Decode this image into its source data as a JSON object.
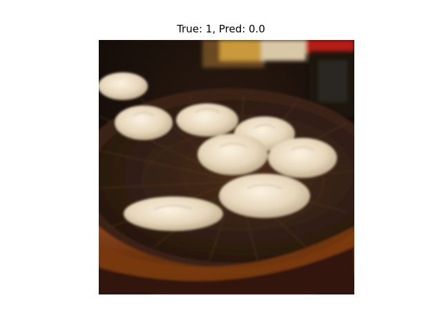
{
  "figure": {
    "title": "True: 1, Pred: 0.0"
  },
  "image": {
    "subject": "soup-dumplings-in-bamboo-steamer",
    "colors": {
      "background": "#120c09",
      "steamer_rim": "#8a4514",
      "steamer_inner": "#2f1d14",
      "dumpling": "#e9dcc4"
    }
  }
}
